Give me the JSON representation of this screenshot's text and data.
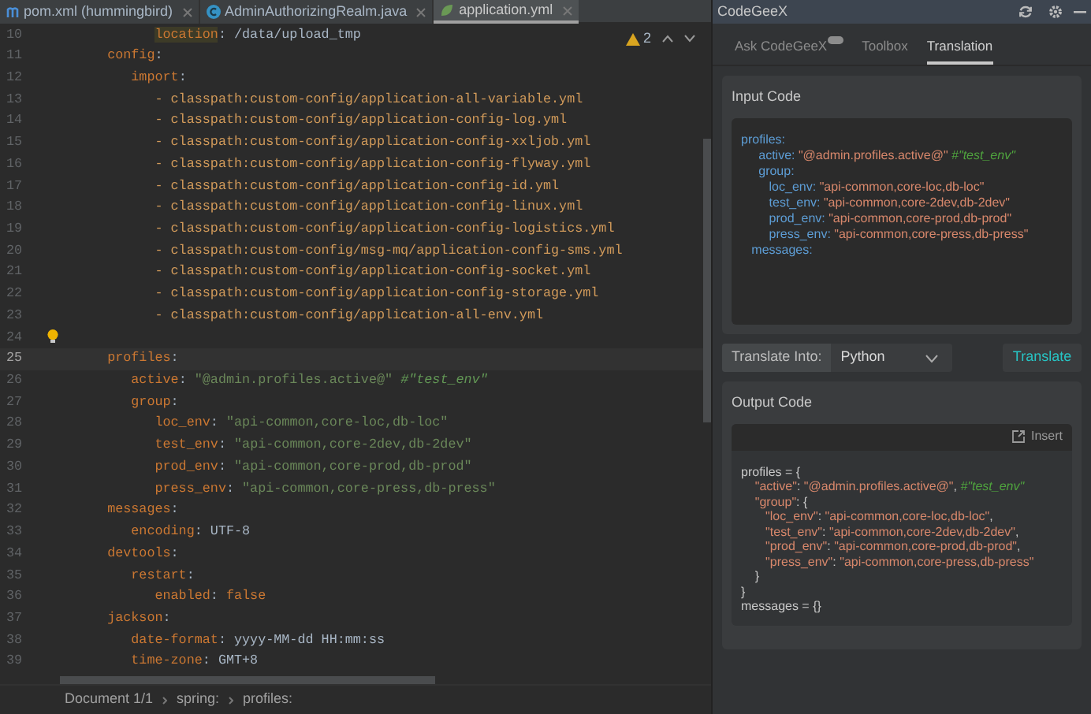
{
  "editor_tabs": [
    {
      "label": "pom.xml (hummingbird)",
      "selected": false
    },
    {
      "label": "AdminAuthorizingRealm.java",
      "selected": false
    },
    {
      "label": "application.yml",
      "selected": true
    }
  ],
  "inspections": {
    "warnings": "2"
  },
  "editor": {
    "lines": [
      {
        "number": "10",
        "current": false,
        "tokens": [
          {
            "kind": "hkey",
            "text": "         location"
          },
          {
            "kind": "plain",
            "text": ": /data/upload_tmp"
          }
        ]
      },
      {
        "number": "11",
        "current": false,
        "tokens": [
          {
            "kind": "key",
            "text": "   config"
          },
          {
            "kind": "plain",
            "text": ":"
          }
        ]
      },
      {
        "number": "12",
        "current": false,
        "tokens": [
          {
            "kind": "key",
            "text": "      import"
          },
          {
            "kind": "plain",
            "text": ":"
          }
        ]
      },
      {
        "number": "13",
        "current": false,
        "tokens": [
          {
            "kind": "item",
            "text": "         - classpath:custom-config/application-all-variable.yml"
          }
        ]
      },
      {
        "number": "14",
        "current": false,
        "tokens": [
          {
            "kind": "item",
            "text": "         - classpath:custom-config/application-config-log.yml"
          }
        ]
      },
      {
        "number": "15",
        "current": false,
        "tokens": [
          {
            "kind": "item",
            "text": "         - classpath:custom-config/application-config-xxljob.yml"
          }
        ]
      },
      {
        "number": "16",
        "current": false,
        "tokens": [
          {
            "kind": "item",
            "text": "         - classpath:custom-config/application-config-flyway.yml"
          }
        ]
      },
      {
        "number": "17",
        "current": false,
        "tokens": [
          {
            "kind": "item",
            "text": "         - classpath:custom-config/application-config-id.yml"
          }
        ]
      },
      {
        "number": "18",
        "current": false,
        "tokens": [
          {
            "kind": "item",
            "text": "         - classpath:custom-config/application-config-linux.yml"
          }
        ]
      },
      {
        "number": "19",
        "current": false,
        "tokens": [
          {
            "kind": "item",
            "text": "         - classpath:custom-config/application-config-logistics.yml"
          }
        ]
      },
      {
        "number": "20",
        "current": false,
        "tokens": [
          {
            "kind": "item",
            "text": "         - classpath:custom-config/msg-mq/application-config-sms.yml"
          }
        ]
      },
      {
        "number": "21",
        "current": false,
        "tokens": [
          {
            "kind": "item",
            "text": "         - classpath:custom-config/application-config-socket.yml"
          }
        ]
      },
      {
        "number": "22",
        "current": false,
        "tokens": [
          {
            "kind": "item",
            "text": "         - classpath:custom-config/application-config-storage.yml"
          }
        ]
      },
      {
        "number": "23",
        "current": false,
        "tokens": [
          {
            "kind": "item",
            "text": "         - classpath:custom-config/application-all-env.yml"
          }
        ]
      },
      {
        "number": "24",
        "current": false,
        "bulb": true
      },
      {
        "number": "25",
        "current": true,
        "tokens": [
          {
            "kind": "key",
            "text": "   profiles"
          },
          {
            "kind": "plain",
            "text": ":"
          }
        ]
      },
      {
        "number": "26",
        "current": false,
        "tokens": [
          {
            "kind": "key",
            "text": "      active"
          },
          {
            "kind": "plain",
            "text": ": "
          },
          {
            "kind": "str",
            "text": "\"@admin.profiles.active@\""
          },
          {
            "kind": "comment",
            "text": " #\"test_env\""
          }
        ]
      },
      {
        "number": "27",
        "current": false,
        "tokens": [
          {
            "kind": "key",
            "text": "      group"
          },
          {
            "kind": "plain",
            "text": ":"
          }
        ]
      },
      {
        "number": "28",
        "current": false,
        "tokens": [
          {
            "kind": "key",
            "text": "         loc_env"
          },
          {
            "kind": "plain",
            "text": ": "
          },
          {
            "kind": "str",
            "text": "\"api-common,core-loc,db-loc\""
          }
        ]
      },
      {
        "number": "29",
        "current": false,
        "tokens": [
          {
            "kind": "key",
            "text": "         test_env"
          },
          {
            "kind": "plain",
            "text": ": "
          },
          {
            "kind": "str",
            "text": "\"api-common,core-2dev,db-2dev\""
          }
        ]
      },
      {
        "number": "30",
        "current": false,
        "tokens": [
          {
            "kind": "key",
            "text": "         prod_env"
          },
          {
            "kind": "plain",
            "text": ": "
          },
          {
            "kind": "str",
            "text": "\"api-common,core-prod,db-prod\""
          }
        ]
      },
      {
        "number": "31",
        "current": false,
        "tokens": [
          {
            "kind": "key",
            "text": "         press_env"
          },
          {
            "kind": "plain",
            "text": ": "
          },
          {
            "kind": "str",
            "text": "\"api-common,core-press,db-press\""
          }
        ]
      },
      {
        "number": "32",
        "current": false,
        "tokens": [
          {
            "kind": "key",
            "text": "   messages"
          },
          {
            "kind": "plain",
            "text": ":"
          }
        ]
      },
      {
        "number": "33",
        "current": false,
        "tokens": [
          {
            "kind": "key",
            "text": "      encoding"
          },
          {
            "kind": "plain",
            "text": ": UTF-8"
          }
        ]
      },
      {
        "number": "34",
        "current": false,
        "tokens": [
          {
            "kind": "key",
            "text": "   devtools"
          },
          {
            "kind": "plain",
            "text": ":"
          }
        ]
      },
      {
        "number": "35",
        "current": false,
        "tokens": [
          {
            "kind": "key",
            "text": "      restart"
          },
          {
            "kind": "plain",
            "text": ":"
          }
        ]
      },
      {
        "number": "36",
        "current": false,
        "tokens": [
          {
            "kind": "key",
            "text": "         enabled"
          },
          {
            "kind": "plain",
            "text": ": "
          },
          {
            "kind": "kw",
            "text": "false"
          }
        ]
      },
      {
        "number": "37",
        "current": false,
        "tokens": [
          {
            "kind": "key",
            "text": "   jackson"
          },
          {
            "kind": "plain",
            "text": ":"
          }
        ]
      },
      {
        "number": "38",
        "current": false,
        "tokens": [
          {
            "kind": "key",
            "text": "      date-format"
          },
          {
            "kind": "plain",
            "text": ": yyyy-MM-dd HH:mm:ss"
          }
        ]
      },
      {
        "number": "39",
        "current": false,
        "tokens": [
          {
            "kind": "key",
            "text": "      time-zone"
          },
          {
            "kind": "plain",
            "text": ": GMT+8"
          }
        ]
      }
    ]
  },
  "breadcrumbs": [
    "Document 1/1",
    "spring:",
    "profiles:"
  ],
  "panel": {
    "title": "CodeGeeX",
    "tabs": [
      {
        "label": "Ask CodeGeeX",
        "badge": true,
        "selected": false
      },
      {
        "label": "Toolbox",
        "badge": false,
        "selected": false
      },
      {
        "label": "Translation",
        "badge": false,
        "selected": true
      }
    ],
    "input": {
      "title": "Input Code",
      "lines": [
        [
          {
            "kind": "key",
            "text": "profiles:"
          }
        ],
        [
          {
            "kind": "key",
            "text": "     active: "
          },
          {
            "kind": "str",
            "text": "\"@admin.profiles.active@\""
          },
          {
            "kind": "comment",
            "text": " #\"test_env\""
          }
        ],
        [
          {
            "kind": "key",
            "text": "     group:"
          }
        ],
        [
          {
            "kind": "key",
            "text": "        loc_env: "
          },
          {
            "kind": "str",
            "text": "\"api-common,core-loc,db-loc\""
          }
        ],
        [
          {
            "kind": "key",
            "text": "        test_env: "
          },
          {
            "kind": "str",
            "text": "\"api-common,core-2dev,db-2dev\""
          }
        ],
        [
          {
            "kind": "key",
            "text": "        prod_env: "
          },
          {
            "kind": "str",
            "text": "\"api-common,core-prod,db-prod\""
          }
        ],
        [
          {
            "kind": "key",
            "text": "        press_env: "
          },
          {
            "kind": "str",
            "text": "\"api-common,core-press,db-press\""
          }
        ],
        [
          {
            "kind": "key",
            "text": "   messages:"
          }
        ]
      ]
    },
    "translate_into": {
      "label": "Translate Into:",
      "value": "Python"
    },
    "translate_button": "Translate",
    "output": {
      "title": "Output Code",
      "insert": "Insert",
      "lines": [
        [
          {
            "kind": "plain",
            "text": "profiles = {"
          }
        ],
        [
          {
            "kind": "str",
            "text": "    \"active\""
          },
          {
            "kind": "plain",
            "text": ": "
          },
          {
            "kind": "str",
            "text": "\"@admin.profiles.active@\""
          },
          {
            "kind": "plain",
            "text": ", "
          },
          {
            "kind": "comment",
            "text": "#\"test_env\""
          }
        ],
        [
          {
            "kind": "str",
            "text": "    \"group\""
          },
          {
            "kind": "plain",
            "text": ": {"
          }
        ],
        [
          {
            "kind": "str",
            "text": "       \"loc_env\""
          },
          {
            "kind": "plain",
            "text": ": "
          },
          {
            "kind": "str",
            "text": "\"api-common,core-loc,db-loc\""
          },
          {
            "kind": "plain",
            "text": ","
          }
        ],
        [
          {
            "kind": "str",
            "text": "       \"test_env\""
          },
          {
            "kind": "plain",
            "text": ": "
          },
          {
            "kind": "str",
            "text": "\"api-common,core-2dev,db-2dev\""
          },
          {
            "kind": "plain",
            "text": ","
          }
        ],
        [
          {
            "kind": "str",
            "text": "       \"prod_env\""
          },
          {
            "kind": "plain",
            "text": ": "
          },
          {
            "kind": "str",
            "text": "\"api-common,core-prod,db-prod\""
          },
          {
            "kind": "plain",
            "text": ","
          }
        ],
        [
          {
            "kind": "str",
            "text": "       \"press_env\""
          },
          {
            "kind": "plain",
            "text": ": "
          },
          {
            "kind": "str",
            "text": "\"api-common,core-press,db-press\""
          }
        ],
        [
          {
            "kind": "plain",
            "text": "    }"
          }
        ],
        [
          {
            "kind": "plain",
            "text": "}"
          }
        ],
        [
          {
            "kind": "plain",
            "text": "messages = {}"
          }
        ]
      ]
    }
  }
}
